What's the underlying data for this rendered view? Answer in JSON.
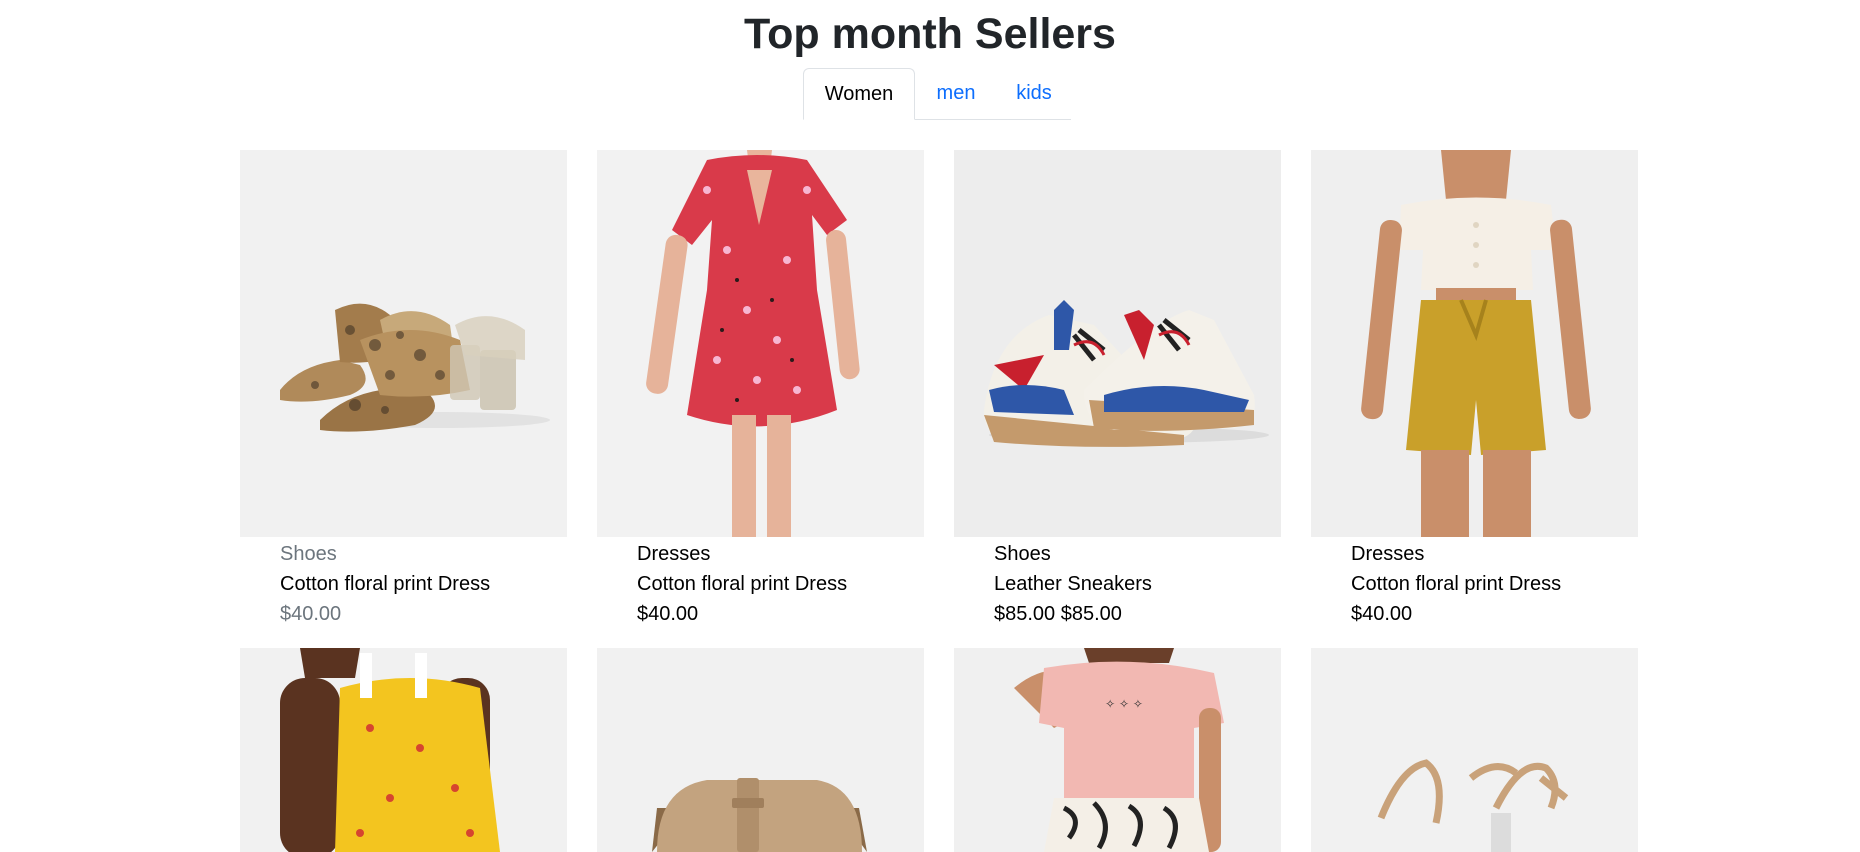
{
  "page": {
    "title": "Top month Sellers"
  },
  "tabs": [
    {
      "label": "Women",
      "active": true
    },
    {
      "label": "men",
      "active": false
    },
    {
      "label": "kids",
      "active": false
    }
  ],
  "products_row1": [
    {
      "category": "Shoes",
      "name": "Cotton floral print Dress",
      "price": "$40.00",
      "image": "snake-print-mule-sandals-icon",
      "muted": true
    },
    {
      "category": "Dresses",
      "name": "Cotton floral print Dress",
      "price": "$40.00",
      "image": "floral-dress-model-icon",
      "muted": false
    },
    {
      "category": "Shoes",
      "name": "Leather Sneakers",
      "price": "$85.00 $85.00",
      "image": "chunky-sneakers-icon",
      "muted": false
    },
    {
      "category": "Dresses",
      "name": "Cotton floral print Dress",
      "price": "$40.00",
      "image": "off-shoulder-top-shorts-model-icon",
      "muted": false
    }
  ],
  "products_row2": [
    {
      "image": "yellow-floral-dress-model-icon"
    },
    {
      "image": "tan-crossbody-bag-icon"
    },
    {
      "image": "pink-tshirt-zebra-skirt-model-icon"
    },
    {
      "image": "strappy-heel-sandal-icon"
    }
  ],
  "colors": {
    "link": "#0d6efd",
    "muted": "#6c757d",
    "image_bg": "#f1f1f1"
  }
}
